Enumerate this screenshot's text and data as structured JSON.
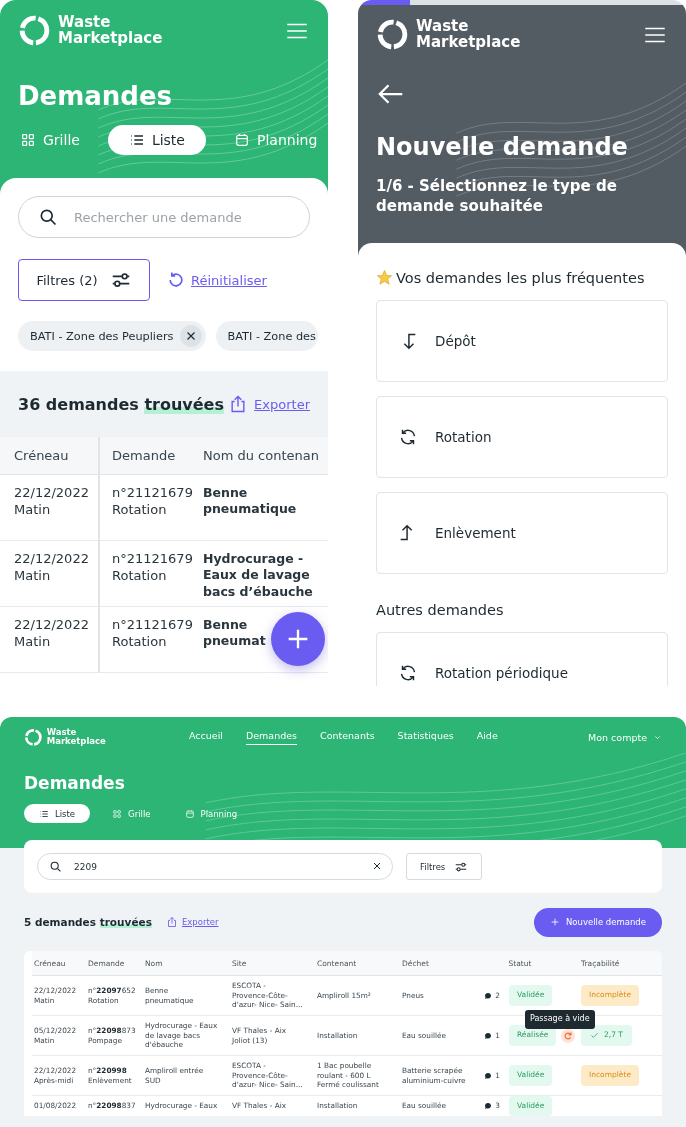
{
  "mobile_list": {
    "logo": "Waste Marketplace",
    "title": "Demandes",
    "view_tabs": [
      {
        "label": "Grille",
        "kind": "grid",
        "selected": false
      },
      {
        "label": "Liste",
        "kind": "list",
        "selected": true
      },
      {
        "label": "Planning",
        "kind": "calendar",
        "selected": false
      }
    ],
    "search": {
      "placeholder": "Rechercher une demande"
    },
    "filters_button": "Filtres (2)",
    "reset_link": "Réinitialiser",
    "chips": [
      {
        "label": "BATI - Zone des Peupliers",
        "removable": true
      },
      {
        "label": "BATI - Zone des",
        "removable": false
      }
    ],
    "results": {
      "text": "36 demandes",
      "highlight": "trouvées"
    },
    "export_link": "Exporter",
    "table": {
      "columns": [
        "Créneau",
        "Demande",
        "Nom du contenan"
      ],
      "rows": [
        [
          "22/12/2022\nMatin",
          "n°21121679\nRotation",
          "Benne\npneumatique"
        ],
        [
          "22/12/2022\nMatin",
          "n°21121679\nRotation",
          "Hydrocurage -\nEaux de lavage\nbacs d’ébauche"
        ],
        [
          "22/12/2022\nMatin",
          "n°21121679\nRotation",
          "Benne\npneumat"
        ]
      ]
    }
  },
  "new_request": {
    "logo": "Waste Marketplace",
    "progress": {
      "level": 0.16
    },
    "title": "Nouvelle demande",
    "step": "1/6 - Sélectionnez le type de demande souhaitée",
    "frequent_title": "Vos demandes les plus fréquentes",
    "frequent_options": [
      {
        "label": "Dépôt",
        "kind": "deposit"
      },
      {
        "label": "Rotation",
        "kind": "rotation"
      },
      {
        "label": "Enlèvement",
        "kind": "removal"
      }
    ],
    "other_title": "Autres demandes",
    "other_options": [
      {
        "label": "Rotation périodique",
        "kind": "rotation"
      }
    ]
  },
  "desktop": {
    "logo": "Waste Marketplace",
    "nav": [
      {
        "label": "Accueil",
        "selected": false
      },
      {
        "label": "Demandes",
        "selected": true
      },
      {
        "label": "Contenants",
        "selected": false
      },
      {
        "label": "Statistiques",
        "selected": false
      },
      {
        "label": "Aide",
        "selected": false
      }
    ],
    "account": "Mon compte",
    "title": "Demandes",
    "view_tabs": [
      {
        "label": "Liste",
        "kind": "list",
        "selected": true
      },
      {
        "label": "Grille",
        "kind": "grid",
        "selected": false
      },
      {
        "label": "Planning",
        "kind": "calendar",
        "selected": false
      }
    ],
    "search": {
      "value": "2209"
    },
    "filters_button": "Filtres",
    "results": {
      "text": "5 demandes",
      "highlight": "trouvées"
    },
    "export_link": "Exporter",
    "new_button": "Nouvelle demande",
    "table": {
      "columns": [
        "Créneau",
        "Demande",
        "Nom",
        "Site",
        "Contenant",
        "Déchet",
        "Statut",
        "Traçabilité"
      ],
      "rows": [
        {
          "slot": "22/12/2022\nMatin",
          "request": "n°**22097**652\nRotation",
          "name": "Benne\npneumatique",
          "site": "ESCOTA -\nProvence-Côte-\nd'azur- Nice- Sain...",
          "container": "Ampliroll 15m²",
          "waste": "Pneus",
          "comments": "2",
          "status": "Validée",
          "empty_run": false,
          "traceability": {
            "label": "Incomplète",
            "kind": "incomplete"
          }
        },
        {
          "slot": "05/12/2022\nMatin",
          "request": "n°**22098**873\nPompage",
          "name": "Hydrocurage - Eaux\nde lavage bacs\nd'ébauche",
          "site": "VF Thales - Aix\nJoliot (13)",
          "container": "Installation",
          "waste": "Eau souillée",
          "comments": "1",
          "status": "Réalisée",
          "empty_run": true,
          "tooltip": "Passage à vide",
          "traceability": {
            "label": "2,7 T",
            "kind": "weight"
          }
        },
        {
          "slot": "22/12/2022\nAprès-midi",
          "request": "n°**220998**\nEnlèvement",
          "name": "Ampliroll entrée\nSUD",
          "site": "ESCOTA -\nProvence-Côte-\nd'azur- Nice- Sain...",
          "container": "1 Bac poubelle\nroulant - 600 L\nFermé coulissant",
          "waste": "Batterie scrapée\naluminium-cuivre",
          "comments": "1",
          "status": "Validée",
          "empty_run": false,
          "traceability": {
            "label": "Incomplète",
            "kind": "incomplete"
          }
        },
        {
          "slot": "01/08/2022",
          "request": "n°**22098**837",
          "name": "Hydrocurage - Eaux",
          "site": "VF Thales - Aix",
          "container": "Installation",
          "waste": "Eau souillée",
          "comments": "3",
          "status": "Validée",
          "empty_run": false
        }
      ]
    }
  }
}
